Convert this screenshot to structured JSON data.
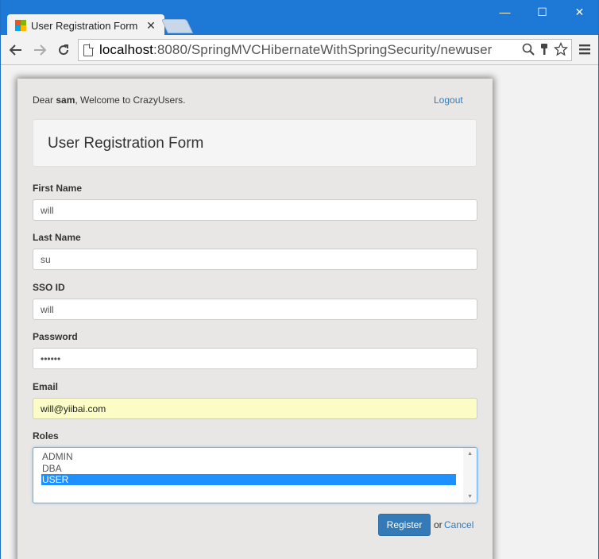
{
  "browser": {
    "tab_title": "User Registration Form",
    "tab_close": "✕",
    "url_host": "localhost",
    "url_rest": ":8080/SpringMVCHibernateWithSpringSecurity/newuser",
    "window_minimize": "—",
    "window_maximize": "☐",
    "window_close": "✕"
  },
  "header": {
    "welcome_prefix": "Dear ",
    "username": "sam",
    "welcome_suffix": ", Welcome to CrazyUsers.",
    "logout_label": "Logout"
  },
  "form": {
    "title": "User Registration Form",
    "first_name_label": "First Name",
    "first_name_value": "will",
    "last_name_label": "Last Name",
    "last_name_value": "su",
    "sso_id_label": "SSO ID",
    "sso_id_value": "will",
    "password_label": "Password",
    "password_value": "••••••",
    "email_label": "Email",
    "email_value": "will@yiibai.com",
    "roles_label": "Roles",
    "roles": [
      "ADMIN",
      "DBA",
      "USER"
    ],
    "selected_role": "USER",
    "register_label": "Register",
    "or_text": "or",
    "cancel_label": "Cancel"
  },
  "colors": {
    "primary": "#337ab7",
    "selected_option": "#1e90ff",
    "autofill": "#fbfcc6",
    "titlebar": "#1e78d6"
  }
}
